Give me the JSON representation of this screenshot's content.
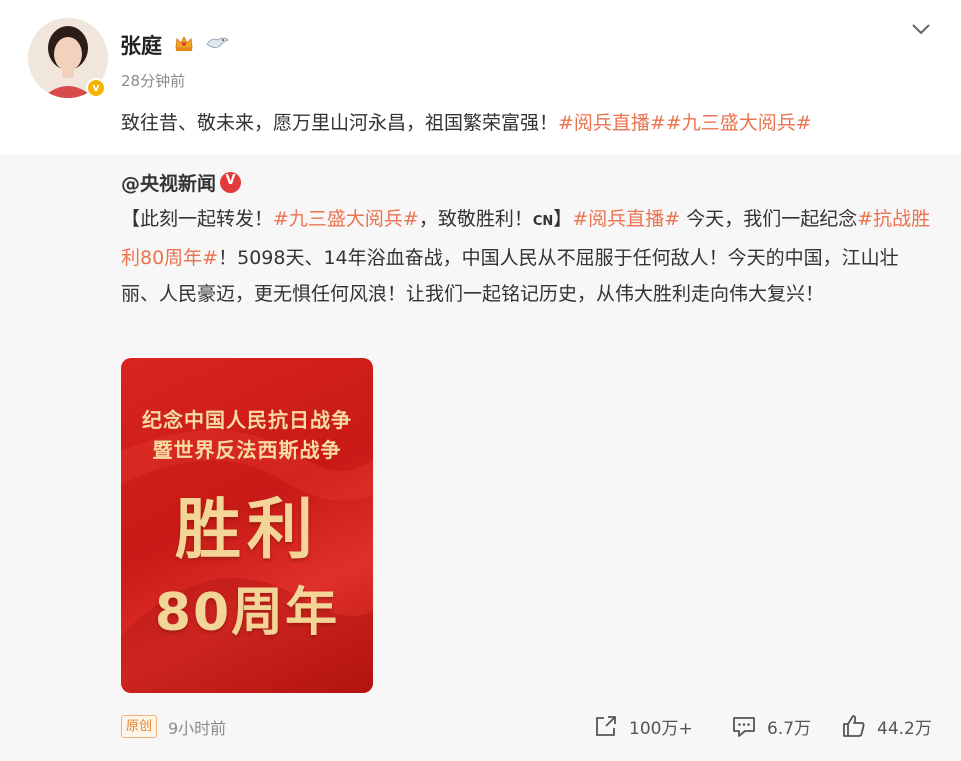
{
  "post": {
    "username": "张庭",
    "time": "28分钟前",
    "text_prefix": "致往昔、敬未来，愿万里山河永昌，祖国繁荣富强！",
    "tags": [
      "#阅兵直播#",
      "#九三盛大阅兵#"
    ]
  },
  "repost": {
    "author": "@央视新闻",
    "author_badge": "V",
    "text_parts": {
      "p1": "【此刻一起转发！",
      "t1": "#九三盛大阅兵#",
      "p2": "，致敬胜利！",
      "cn": "CN",
      "p3": "】",
      "t2": "#阅兵直播#",
      "p4": " 今天，我们一起纪念",
      "t3": "#抗战胜利80周年#",
      "p5": "！5098天、14年浴血奋战，中国人民从不屈服于任何敌人！今天的中国，江山壮丽、人民豪迈，更无惧任何风浪！让我们一起铭记历史，从伟大胜利走向伟大复兴！"
    },
    "poster": {
      "line1": "纪念中国人民抗日战争",
      "line2": "暨世界反法西斯战争",
      "line3": "胜利",
      "line4": "80周年"
    },
    "original_badge": "原创",
    "time": "9小时前",
    "actions": {
      "share_count": "100万+",
      "comment_count": "6.7万",
      "like_count": "44.2万"
    }
  },
  "colors": {
    "tag": "#eb7350",
    "verified_gold": "#f5b400",
    "verified_red": "#e03a3a"
  }
}
